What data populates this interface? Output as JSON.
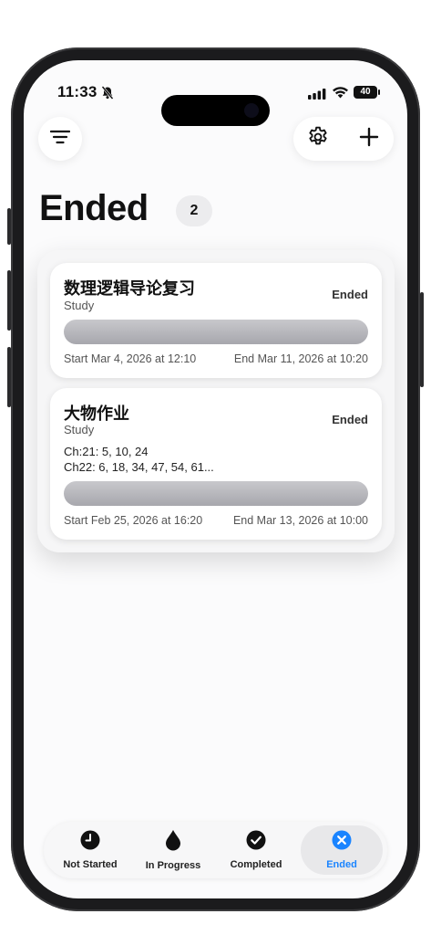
{
  "status_bar": {
    "time": "11:33",
    "battery": "40"
  },
  "header": {
    "title": "Ended",
    "count": "2",
    "icons": [
      "filter-icon",
      "gear-icon",
      "plus-icon"
    ]
  },
  "cards": [
    {
      "title": "数理逻辑导论复习",
      "category": "Study",
      "status": "Ended",
      "start": "Start Mar 4, 2026 at 12:10",
      "end": "End Mar 11, 2026 at 10:20"
    },
    {
      "title": "大物作业",
      "category": "Study",
      "status": "Ended",
      "note_line1": "Ch:21: 5, 10, 24",
      "note_line2": "Ch22: 6, 18, 34, 47, 54, 61...",
      "start": "Start Feb 25, 2026 at 16:20",
      "end": "End Mar 13, 2026 at 10:00"
    }
  ],
  "tabs": [
    {
      "label": "Not Started",
      "icon": "clock-icon"
    },
    {
      "label": "In Progress",
      "icon": "drop-icon"
    },
    {
      "label": "Completed",
      "icon": "checkmark-icon"
    },
    {
      "label": "Ended",
      "icon": "xmark-icon",
      "active": true
    }
  ],
  "colors": {
    "accent": "#1a84ff"
  }
}
